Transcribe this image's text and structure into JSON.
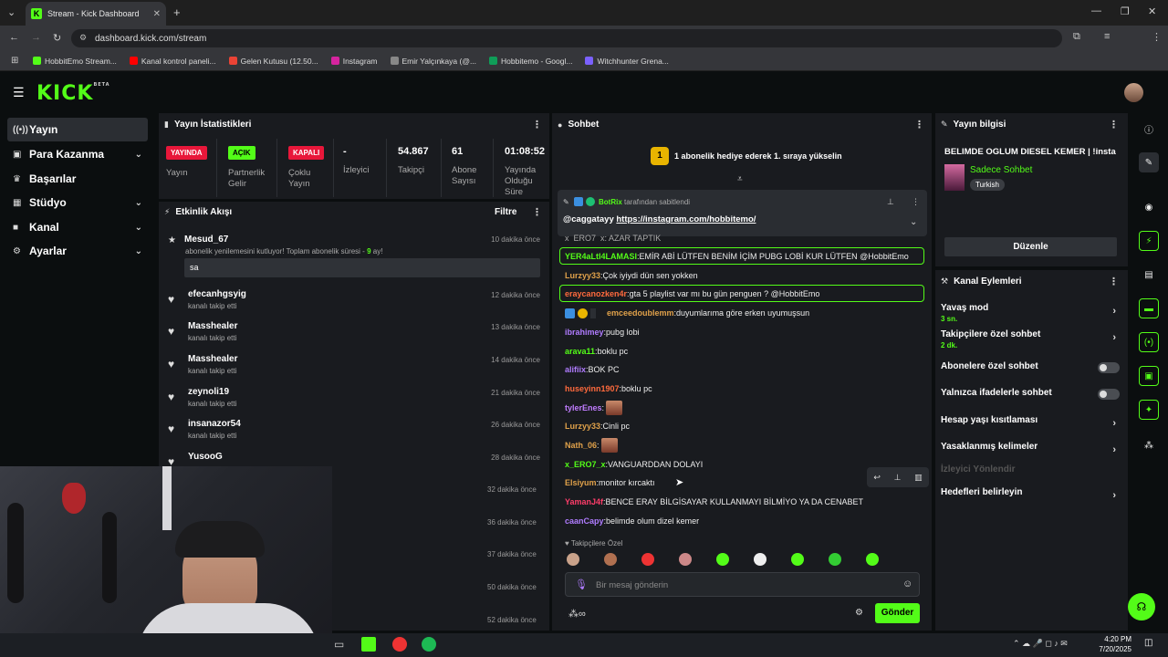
{
  "browser": {
    "tab_title": "Stream - Kick Dashboard",
    "url": "dashboard.kick.com/stream",
    "bookmarks": [
      "HobbitEmo Stream...",
      "Kanal kontrol paneli...",
      "Gelen Kutusu (12.50...",
      "Instagram",
      "Emir Yalçınkaya (@...",
      "Hobbitemo - Googl...",
      "Witchhunter Grena..."
    ]
  },
  "brand": {
    "logo": "KICK",
    "beta": "BETA"
  },
  "sidebar": {
    "items": [
      {
        "label": "Yayın"
      },
      {
        "label": "Para Kazanma"
      },
      {
        "label": "Başarılar"
      },
      {
        "label": "Stüdyo"
      },
      {
        "label": "Kanal"
      },
      {
        "label": "Ayarlar"
      }
    ]
  },
  "stats": {
    "title": "Yayın İstatistikleri",
    "items": [
      {
        "badge": "YAYINDA",
        "label": "Yayın"
      },
      {
        "badge": "AÇIK",
        "label": "Partnerlik Gelir"
      },
      {
        "badge": "KAPALI",
        "label": "Çoklu Yayın"
      },
      {
        "value": "-",
        "label": "İzleyici"
      },
      {
        "value": "54.867",
        "label": "Takipçi"
      },
      {
        "value": "61",
        "label": "Abone Sayısı"
      },
      {
        "value": "01:08:52",
        "label": "Yayında Olduğu Süre"
      }
    ]
  },
  "activity": {
    "title": "Etkinlik Akışı",
    "filter": "Filtre",
    "first": {
      "name": "Mesud_67",
      "text_a": "abonelik yenilemesini kutluyor! Toplam abonelik süresi - ",
      "months": "9",
      "text_b": " ay!",
      "time": "10 dakika önce",
      "message": "sa"
    },
    "items": [
      {
        "name": "efecanhgsyig",
        "sub": "kanalı takip etti",
        "time": "12 dakika önce"
      },
      {
        "name": "Masshealer",
        "sub": "kanalı takip etti",
        "time": "13 dakika önce"
      },
      {
        "name": "Masshealer",
        "sub": "kanalı takip etti",
        "time": "14 dakika önce"
      },
      {
        "name": "zeynoli19",
        "sub": "kanalı takip etti",
        "time": "21 dakika önce"
      },
      {
        "name": "insanazor54",
        "sub": "kanalı takip etti",
        "time": "26 dakika önce"
      },
      {
        "name": "YusooG",
        "sub": "",
        "time": "28 dakika önce"
      }
    ],
    "hidden_times": [
      "32 dakika önce",
      "36 dakika önce",
      "37 dakika önce",
      "50 dakika önce",
      "52 dakika önce"
    ]
  },
  "chat": {
    "title": "Sohbet",
    "gift_badge": "1",
    "gift_text": "1 abonelik hediye ederek 1. sıraya yükselin",
    "pinned": {
      "author": "BotRix",
      "by": " tarafından sabitlendi",
      "mention": "@caggatayy ",
      "link": "https://instagram.com/hobbitemo/"
    },
    "partial_top": "x_ERO7_x: AZAR TAPTIK",
    "messages": [
      {
        "user": "YER4aLtI4LAMASI",
        "color": "#53fc18",
        "text": "EMİR ABİ LÜTFEN BENİM İÇİM PUBG LOBİ KUR LÜTFEN @HobbitEmo",
        "hl": true
      },
      {
        "user": "Lurzyy33",
        "color": "#e0a14a",
        "text": "Çok iyiydi dün sen yokken"
      },
      {
        "user": "eraycanozken4r",
        "color": "#ff6a3d",
        "text": "gta 5 playlist var mı bu gün penguen ? @HobbitEmo",
        "hl": true
      },
      {
        "user": "emceedoublemm",
        "color": "#e0a14a",
        "text": "duyumlarıma göre erken uyumuşsun",
        "badges": true
      },
      {
        "user": "ibrahimey",
        "color": "#b07cff",
        "text": "pubg lobi"
      },
      {
        "user": "arava11",
        "color": "#53fc18",
        "text": "boklu pc"
      },
      {
        "user": "alifiix",
        "color": "#b07cff",
        "text": "BOK PC"
      },
      {
        "user": "huseyinn1907",
        "color": "#ff6a3d",
        "text": "boklu pc"
      },
      {
        "user": "tylerEnes",
        "color": "#c07cff",
        "text": "",
        "emote": true
      },
      {
        "user": "Lurzyy33",
        "color": "#e0a14a",
        "text": "Cinli pc"
      },
      {
        "user": "Nath_06",
        "color": "#e0a14a",
        "text": "",
        "emote": true
      },
      {
        "user": "x_ERO7_x",
        "color": "#53fc18",
        "text": "VANGUARDDAN DOLAYI"
      },
      {
        "user": "Elsiyum",
        "color": "#e0a14a",
        "text": "monitor kırcaktı"
      },
      {
        "user": "YamanJ4f",
        "color": "#ff3d6a",
        "text": "BENCE ERAY BİLGİSAYAR KULLANMAYI BİLMİYO YA DA CENABET"
      },
      {
        "user": "caanCapy",
        "color": "#b07cff",
        "text": "belimde olum dizel kemer"
      }
    ],
    "followers_only": "Takipçilere Özel",
    "input_placeholder": "Bir mesaj gönderin",
    "send": "Gönder"
  },
  "stream_info": {
    "title": "Yayın bilgisi",
    "stream_title": "BELIMDE OGLUM DIESEL KEMER | !insta",
    "category": "Sadece Sohbet",
    "language": "Turkish",
    "edit": "Düzenle"
  },
  "channel_actions": {
    "title": "Kanal Eylemleri",
    "items": [
      {
        "label": "Yavaş mod",
        "sub": "3 sn.",
        "kind": "chev"
      },
      {
        "label": "Takipçilere özel sohbet",
        "sub": "2 dk.",
        "kind": "chev"
      },
      {
        "label": "Abonelere özel sohbet",
        "kind": "toggle"
      },
      {
        "label": "Yalnızca ifadelerle sohbet",
        "kind": "toggle"
      },
      {
        "label": "Hesap yaşı kısıtlaması",
        "kind": "chev"
      },
      {
        "label": "Yasaklanmış kelimeler",
        "kind": "chev"
      },
      {
        "label": "İzleyici Yönlendir",
        "kind": "disabled"
      },
      {
        "label": "Hedefleri belirleyin",
        "kind": "chev"
      }
    ]
  },
  "taskbar": {
    "time": "4:20 PM",
    "date": "7/20/2025"
  },
  "colors": {
    "accent": "#53fc18",
    "live": "#e8173a",
    "panel": "#191b1f",
    "bg": "#0b0e0f"
  }
}
